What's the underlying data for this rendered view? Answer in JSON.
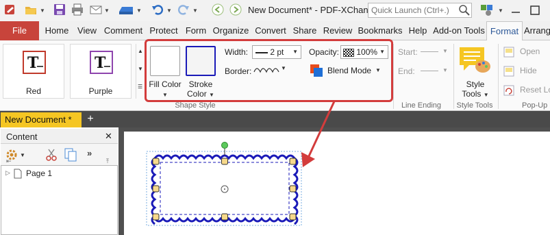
{
  "title_bar": {
    "title": "New Document* - PDF-XChang...",
    "quick_launch_placeholder": "Quick Launch (Ctrl+.)",
    "icons": [
      "app-icon",
      "open-folder-icon",
      "save-icon",
      "print-icon",
      "email-icon",
      "scanner-icon",
      "undo-icon",
      "redo-icon",
      "back-icon",
      "forward-icon",
      "search-icon",
      "ui-options-icon",
      "minimize-icon",
      "maximize-icon"
    ]
  },
  "ribbon_tabs": {
    "file": "File",
    "tabs": [
      "Home",
      "View",
      "Comment",
      "Protect",
      "Form",
      "Organize",
      "Convert",
      "Share",
      "Review",
      "Bookmarks",
      "Help",
      "Add-on Tools",
      "Format",
      "Arrange"
    ],
    "active": "Format"
  },
  "ribbon": {
    "styles": [
      {
        "label": "Red",
        "glyph": "T",
        "border_color": "#c0392b"
      },
      {
        "label": "Purple",
        "glyph": "T",
        "border_color": "#8e44ad"
      }
    ],
    "shape_style": {
      "group_label": "Shape Style",
      "fill_color_label": "Fill Color",
      "stroke_color_label": "Stroke Color",
      "width_label": "Width:",
      "width_value": "2 pt",
      "border_label": "Border:",
      "opacity_label": "Opacity:",
      "opacity_value": "100%",
      "blend_mode_label": "Blend Mode",
      "fill_color": "#ffffff",
      "stroke_color": "#1a1ab8"
    },
    "line_ending": {
      "group_label": "Line Ending",
      "start_label": "Start:",
      "end_label": "End:"
    },
    "style_tools": {
      "group_label": "Style Tools",
      "button_label": "Style Tools"
    },
    "popup": {
      "group_label": "Pop-Up",
      "open_label": "Open",
      "hide_label": "Hide",
      "reset_label": "Reset Lo"
    }
  },
  "document_tabs": {
    "active_tab": "New Document *"
  },
  "content_pane": {
    "title": "Content",
    "tree": [
      {
        "label": "Page 1"
      }
    ]
  },
  "annotation": {
    "stroke_color": "#1a1ab8",
    "handle_color": "#f7d98b",
    "rotate_handle_color": "#5cc95c"
  },
  "colors": {
    "file_tab": "#c8443b",
    "highlight": "#d33c3c",
    "doc_tab": "#f5c623",
    "accent": "#2b5797"
  }
}
